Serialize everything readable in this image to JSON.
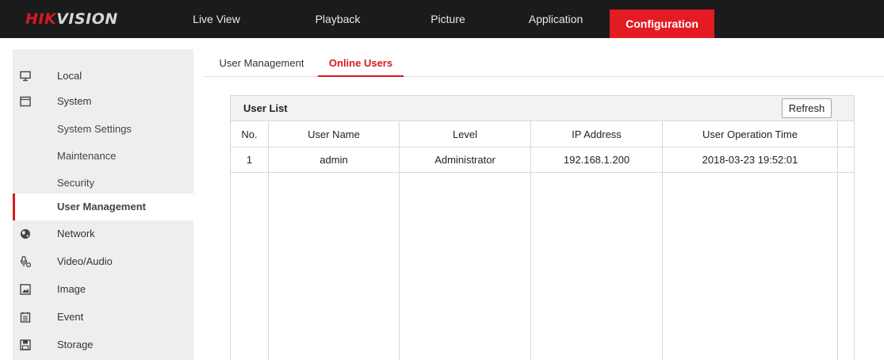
{
  "header": {
    "logo_red": "HIK",
    "logo_rest": "VISION",
    "nav": [
      {
        "label": "Live View",
        "active": false
      },
      {
        "label": "Playback",
        "active": false
      },
      {
        "label": "Picture",
        "active": false
      },
      {
        "label": "Application",
        "active": false
      },
      {
        "label": "Configuration",
        "active": true
      }
    ]
  },
  "sidebar": {
    "items": [
      {
        "label": "Local",
        "icon": "monitor-icon"
      },
      {
        "label": "System",
        "icon": "window-icon"
      },
      {
        "label": "System Settings"
      },
      {
        "label": "Maintenance"
      },
      {
        "label": "Security"
      },
      {
        "label": "User Management",
        "selected": true
      },
      {
        "label": "Network",
        "icon": "globe-icon"
      },
      {
        "label": "Video/Audio",
        "icon": "microphone-icon"
      },
      {
        "label": "Image",
        "icon": "image-icon"
      },
      {
        "label": "Event",
        "icon": "calendar-icon"
      },
      {
        "label": "Storage",
        "icon": "floppy-disk-icon"
      }
    ]
  },
  "tabs": [
    {
      "label": "User Management",
      "active": false
    },
    {
      "label": "Online Users",
      "active": true
    }
  ],
  "user_list": {
    "title": "User List",
    "refresh_label": "Refresh",
    "columns": [
      "No.",
      "User Name",
      "Level",
      "IP Address",
      "User Operation Time"
    ],
    "rows": [
      [
        "1",
        "admin",
        "Administrator",
        "192.168.1.200",
        "2018-03-23 19:52:01"
      ]
    ]
  },
  "colors": {
    "accent": "#e31b23",
    "topbar": "#1b1b1b",
    "sidebar": "#eeeeee"
  }
}
